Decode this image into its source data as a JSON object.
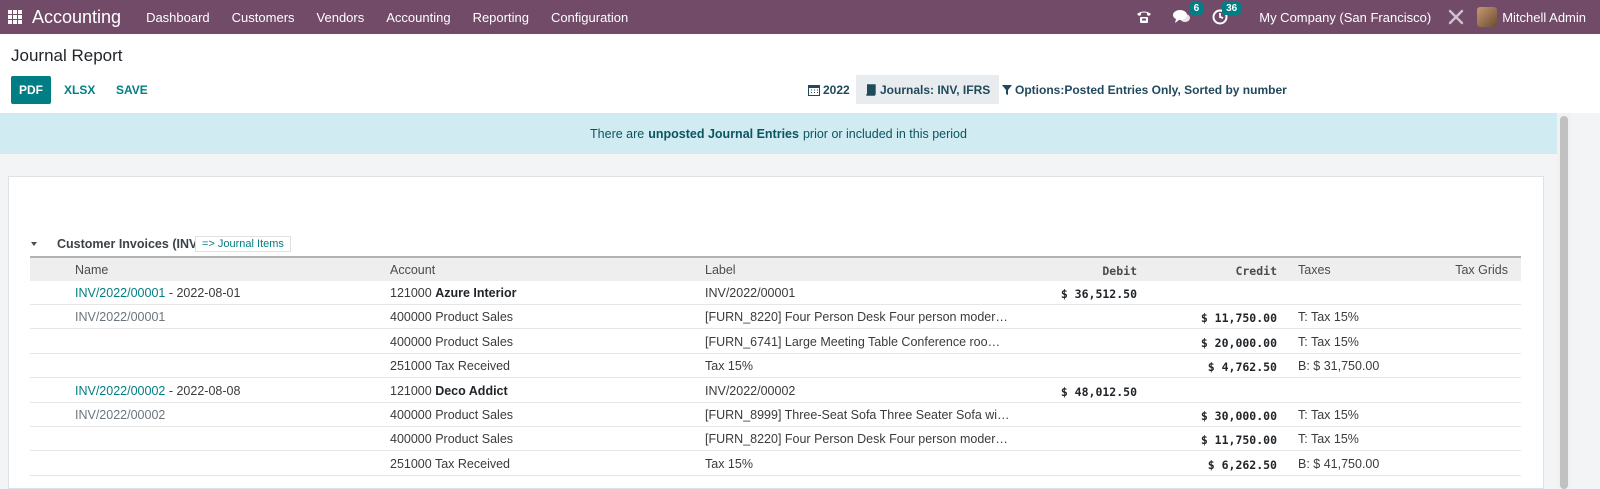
{
  "navbar": {
    "app_title": "Accounting",
    "menu": [
      "Dashboard",
      "Customers",
      "Vendors",
      "Accounting",
      "Reporting",
      "Configuration"
    ],
    "messages_count": "6",
    "activities_count": "36",
    "company": "My Company (San Francisco)",
    "user": "Mitchell Admin"
  },
  "control": {
    "title": "Journal Report",
    "pdf_label": "PDF",
    "xlsx_label": "XLSX",
    "save_label": "SAVE",
    "period": "2022",
    "journals": "Journals: INV, IFRS",
    "options": "Options:Posted Entries Only, Sorted by number"
  },
  "banner": {
    "before": "There are",
    "bold": "unposted Journal Entries",
    "after": "prior or included in this period"
  },
  "report": {
    "section_title": "Customer Invoices (INV)",
    "journal_items_label": "=> Journal Items",
    "columns": {
      "name": "Name",
      "account": "Account",
      "label": "Label",
      "debit": "Debit",
      "credit": "Credit",
      "taxes": "Taxes",
      "tax_grids": "Tax Grids"
    },
    "rows": [
      {
        "name_link": "INV/2022/00001",
        "name_rest": " - 2022-08-01",
        "account_code": "121000",
        "account_name": "Azure Interior",
        "label": "INV/2022/00001",
        "debit": "$ 36,512.50",
        "credit": "",
        "taxes": "",
        "header": true
      },
      {
        "name_link": "",
        "name_rest": "INV/2022/00001",
        "account_code": "400000",
        "account_name": "Product Sales",
        "label": "[FURN_8220] Four Person Desk Four person moder…",
        "debit": "",
        "credit": "$ 11,750.00",
        "taxes": "T: Tax 15%",
        "header": false
      },
      {
        "name_link": "",
        "name_rest": "",
        "account_code": "400000",
        "account_name": "Product Sales",
        "label": "[FURN_6741] Large Meeting Table Conference roo…",
        "debit": "",
        "credit": "$ 20,000.00",
        "taxes": "T: Tax 15%",
        "header": false
      },
      {
        "name_link": "",
        "name_rest": "",
        "account_code": "251000",
        "account_name": "Tax Received",
        "label": "Tax 15%",
        "debit": "",
        "credit": "$ 4,762.50",
        "taxes": "B: $ 31,750.00",
        "header": false
      },
      {
        "name_link": "INV/2022/00002",
        "name_rest": " - 2022-08-08",
        "account_code": "121000",
        "account_name": "Deco Addict",
        "label": "INV/2022/00002",
        "debit": "$ 48,012.50",
        "credit": "",
        "taxes": "",
        "header": true
      },
      {
        "name_link": "",
        "name_rest": "INV/2022/00002",
        "account_code": "400000",
        "account_name": "Product Sales",
        "label": "[FURN_8999] Three-Seat Sofa Three Seater Sofa wi…",
        "debit": "",
        "credit": "$ 30,000.00",
        "taxes": "T: Tax 15%",
        "header": false
      },
      {
        "name_link": "",
        "name_rest": "",
        "account_code": "400000",
        "account_name": "Product Sales",
        "label": "[FURN_8220] Four Person Desk Four person moder…",
        "debit": "",
        "credit": "$ 11,750.00",
        "taxes": "T: Tax 15%",
        "header": false
      },
      {
        "name_link": "",
        "name_rest": "",
        "account_code": "251000",
        "account_name": "Tax Received",
        "label": "Tax 15%",
        "debit": "",
        "credit": "$ 6,262.50",
        "taxes": "B: $ 41,750.00",
        "header": false
      }
    ]
  },
  "colors": {
    "navbar": "#714b67",
    "primary": "#017e84",
    "banner_bg": "#d0ebf2",
    "banner_text": "#0c5460"
  }
}
